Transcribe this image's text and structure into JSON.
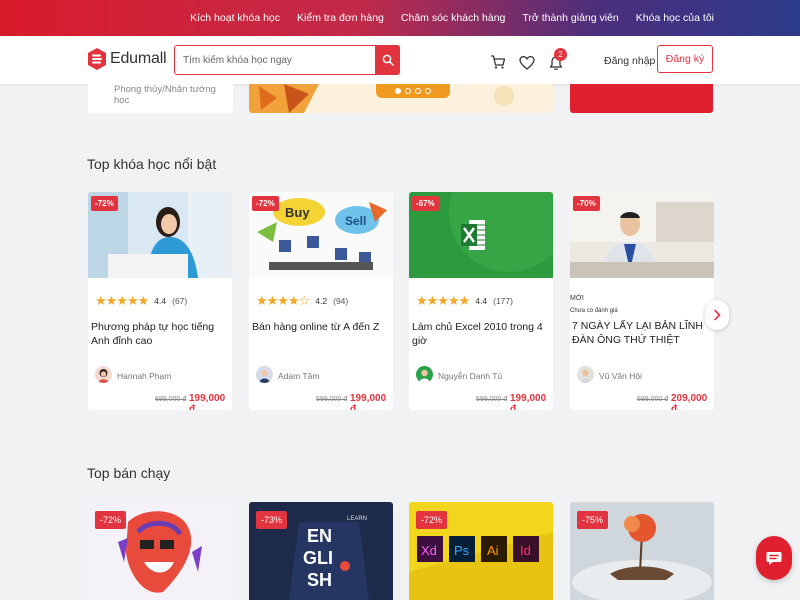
{
  "topnav": {
    "items": [
      "Kích hoạt khóa học",
      "Kiểm tra đơn hàng",
      "Chăm sóc khách hàng",
      "Trở thành giảng viên",
      "Khóa học của tôi"
    ]
  },
  "header": {
    "logo_text": "Edumall",
    "search_placeholder": "Tìm kiếm khóa học ngay",
    "notification_count": "2",
    "login_label": "Đăng nhập",
    "register_label": "Đăng ký"
  },
  "hero": {
    "card1_text": "Phong thủy/Nhân tướng học",
    "slide_count": 4,
    "active_slide": 1
  },
  "sections": {
    "top_title": "Top khóa học nổi bật",
    "bestseller_title": "Top bán chạy"
  },
  "top_courses": [
    {
      "discount": "-72%",
      "rating": "4.4",
      "count": "(67)",
      "title": "Phương pháp tự học tiếng Anh đỉnh cao",
      "author": "Hannah Phạm",
      "old_price": "699,000 đ",
      "price": "199,000 đ"
    },
    {
      "discount": "-72%",
      "rating": "4.2",
      "count": "(94)",
      "title": "Bán hàng online từ A đến Z",
      "author": "Adam Tâm",
      "old_price": "699,000 đ",
      "price": "199,000 đ"
    },
    {
      "discount": "-67%",
      "rating": "4.4",
      "count": "(177)",
      "title": "Làm chủ Excel 2010 trong 4 giờ",
      "author": "Nguyễn Danh Tú",
      "old_price": "599,000 đ",
      "price": "199,000 đ"
    },
    {
      "discount": "-70%",
      "new_tag": "MỚI",
      "no_rating": "Chưa có đánh giá",
      "title": "7 NGÀY LẤY LẠI BẢN LĨNH ĐÀN ÔNG THỨ THIỆT",
      "author": "Vũ Văn Hội",
      "old_price": "699,000 đ",
      "price": "209,000 đ"
    }
  ],
  "bestsellers": [
    {
      "discount": "-72%"
    },
    {
      "discount": "-73%"
    },
    {
      "discount": "-72%"
    },
    {
      "discount": "-75%"
    }
  ],
  "thumb_text": {
    "buy": "Buy",
    "sell": "Sell",
    "english": [
      "EN",
      "GLI",
      "SH"
    ],
    "learn": "LEARN",
    "adobe": [
      "Xd",
      "Ps",
      "Ai",
      "Id"
    ]
  },
  "colors": {
    "brand_red": "#e2343f",
    "star": "#f5a623"
  },
  "icons": [
    "search-icon",
    "cart-icon",
    "heart-icon",
    "bell-icon",
    "chevron-right-icon",
    "chat-icon"
  ]
}
